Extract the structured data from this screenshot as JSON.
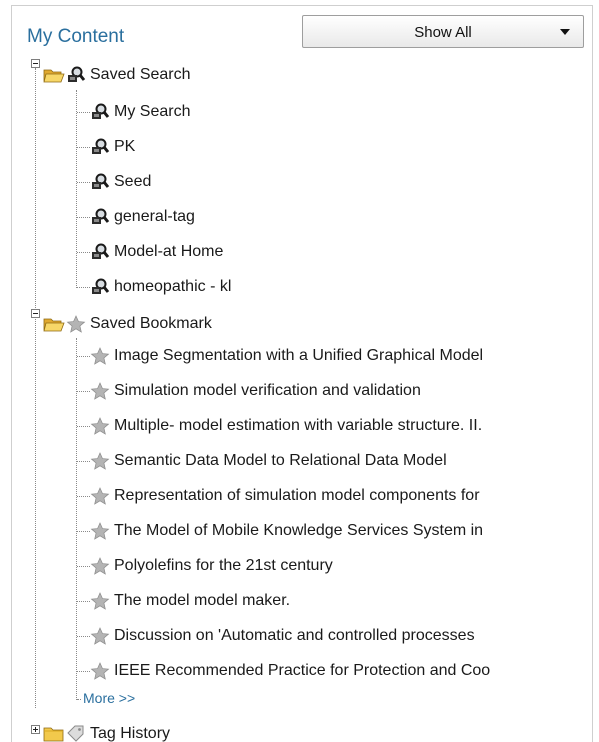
{
  "panel": {
    "title": "My Content",
    "filter": {
      "selected": "Show All"
    }
  },
  "tree": {
    "saved_search": {
      "label": "Saved Search",
      "items": [
        "My Search",
        "PK",
        "Seed",
        "general-tag",
        "Model-at Home",
        "homeopathic - kl"
      ]
    },
    "saved_bookmark": {
      "label": "Saved Bookmark",
      "items": [
        "Image Segmentation with a Unified Graphical Model",
        "Simulation model verification and validation",
        "Multiple- model estimation with variable structure. II.",
        "Semantic Data Model to Relational Data Model",
        "Representation of simulation model components for",
        "The Model of Mobile Knowledge Services System in",
        "Polyolefins for the 21st century",
        "The model model maker.",
        "Discussion on 'Automatic and controlled processes",
        "IEEE Recommended Practice for Protection and Coo"
      ],
      "more_label": "More >>"
    },
    "tag_history": {
      "label": "Tag History"
    }
  },
  "icons": {
    "expander_expanded": "minus-box-icon",
    "expander_collapsed": "plus-box-icon",
    "folder_open": "open-folder-icon",
    "folder_closed": "closed-folder-icon",
    "search": "saved-search-icon",
    "bookmark": "star-icon",
    "tag": "tag-icon"
  },
  "colors": {
    "title": "#2a6f9e",
    "link": "#2a6f9e",
    "folder": "#f2c94c",
    "star": "#9a9a9a"
  }
}
